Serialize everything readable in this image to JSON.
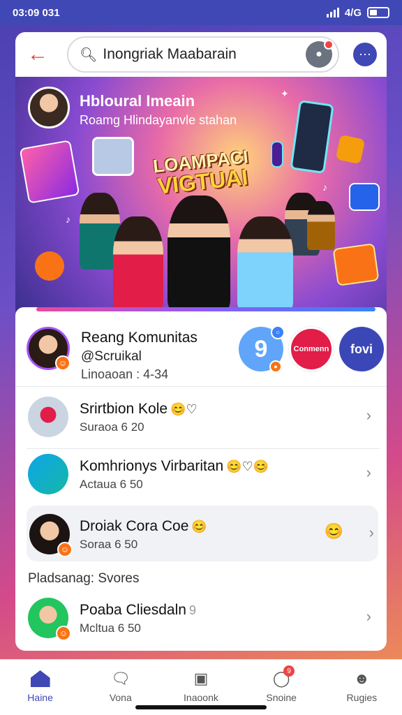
{
  "status": {
    "time": "03:09 031",
    "battery": "4/G"
  },
  "topbar": {
    "back_icon": "back-arrow-icon",
    "search_text": "Inongriak Maabarain",
    "more_icon": "more-dots-icon"
  },
  "hero": {
    "title": "Hbloural Imeain",
    "subtitle": "Roamg Hlindayanvle stahan",
    "logo_line1": "LOAMPACI",
    "logo_line2": "VIGTUAI"
  },
  "community": {
    "name": "Reang Komunitas",
    "handle": "@Scruikal",
    "meta": "Linoaoan : 4-34",
    "icon1": "9",
    "icon2": "Conmenn",
    "icon3": "fovi"
  },
  "list": [
    {
      "title": "Srirtbion Kole",
      "emoji": "😊♡",
      "sub": "Suraoa 6 20"
    },
    {
      "title": "Komhrionys Virbaritan",
      "emoji": "😊♡😊",
      "sub": "Actaua 6 50"
    },
    {
      "title": "Droiak Cora Coe",
      "emoji": "😊",
      "sub": "Soraa 6 50",
      "side_emoji": "😊"
    }
  ],
  "section_label": "Pladsanag: Svores",
  "list2": [
    {
      "title": "Poaba Cliesdaln",
      "emoji": "9",
      "sub": "Mcltua 6 50"
    }
  ],
  "nav": [
    {
      "label": "Haine",
      "icon": "home-icon"
    },
    {
      "label": "Vona",
      "icon": "chat-bubble-icon"
    },
    {
      "label": "Inaoonk",
      "icon": "inbox-icon"
    },
    {
      "label": "Snoine",
      "icon": "notification-bubble-icon",
      "badge": "9"
    },
    {
      "label": "Rugies",
      "icon": "profile-icon"
    }
  ],
  "colors": {
    "primary": "#3f48b5",
    "accent": "#e0403a",
    "badge": "#ef4444"
  }
}
